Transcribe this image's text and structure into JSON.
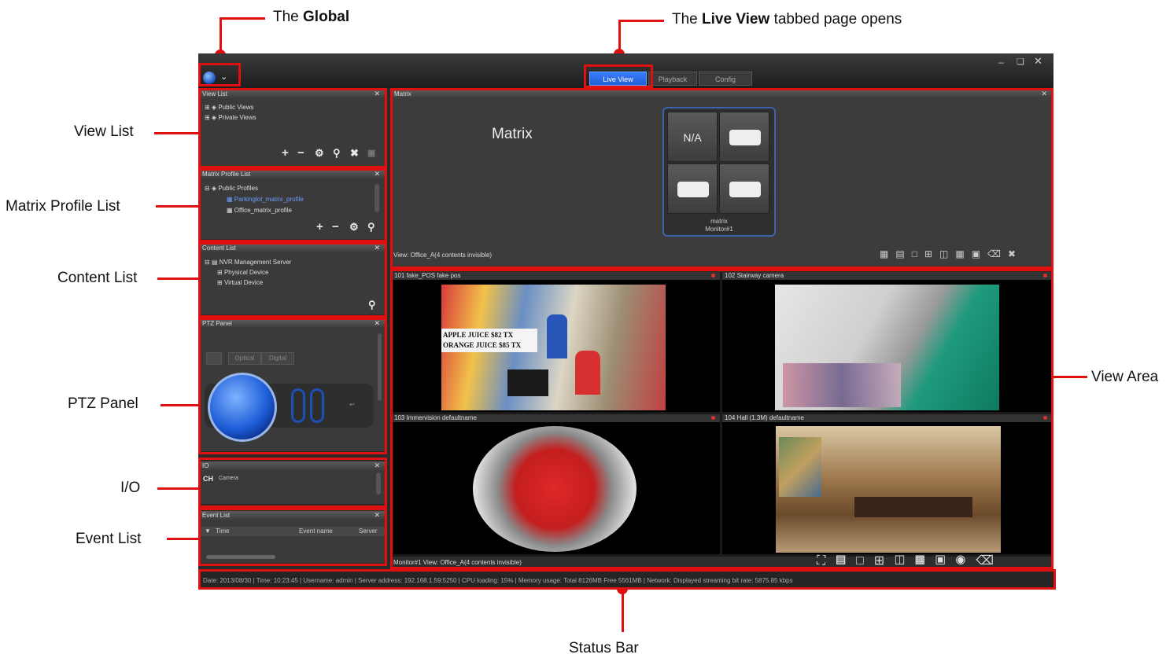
{
  "callouts": {
    "global_prefix": "The ",
    "global_bold": "Global",
    "liveview_prefix": "The ",
    "liveview_bold": "Live View",
    "liveview_suffix": " tabbed page opens",
    "view_list": "View List",
    "matrix_profile_list": "Matrix Profile List",
    "content_list": "Content List",
    "ptz_panel": "PTZ Panel",
    "io": "I/O",
    "event_list": "Event List",
    "view_area": "View Area",
    "status_bar": "Status Bar"
  },
  "tabs": [
    {
      "label": "Live View",
      "active": true
    },
    {
      "label": "Playback",
      "active": false
    },
    {
      "label": "Config",
      "active": false
    }
  ],
  "panels": {
    "view_list": {
      "title": "View List",
      "items": [
        "Public Views",
        "Private Views"
      ]
    },
    "matrix_profile": {
      "title": "Matrix Profile List",
      "items": [
        "Public Profiles",
        "Parkinglot_matrix_profile",
        "Office_matrix_profile"
      ]
    },
    "content_list": {
      "title": "Content List",
      "items": [
        "NVR Management Server",
        "Physical Device",
        "Virtual Device"
      ]
    },
    "ptz": {
      "title": "PTZ Panel",
      "tab_optical": "Optical",
      "tab_digital": "Digital"
    },
    "io": {
      "title": "IO",
      "ch_label": "CH",
      "camera_label": "Camera"
    },
    "event_list": {
      "title": "Event List",
      "col_time": "Time",
      "col_event": "Event name",
      "col_server": "Server"
    }
  },
  "matrix": {
    "header": "Matrix",
    "label": "Matrix",
    "cell_na": "N/A",
    "caption_line1": "matrix",
    "caption_line2": "Monitor#1",
    "view_label": "View: Office_A(4 contents invisible)"
  },
  "cameras": [
    {
      "title": "101  fake_POS  fake pos",
      "overlay1": "APPLE JUICE      $82 TX",
      "overlay2": "ORANGE JUICE    $85 TX"
    },
    {
      "title": "102  Stairway  camera"
    },
    {
      "title": "103  Immervision  defaultname"
    },
    {
      "title": "104  Hall (1.3M)  defaultname"
    }
  ],
  "viewarea_footer": "Monitor#1  View: Office_A(4 contents invisible)",
  "status_text": "Date: 2013/08/30  |  Time: 10:23:45  |  Username: admin  |  Server address: 192.168.1.59:5250  |  CPU loading: 15%  |  Memory usage: Total 8126MB Free 5561MB  |  Network: Displayed streaming bit rate: 5875.85 kbps",
  "colors": {
    "accent_red": "#e01010",
    "tab_active": "#1f5fd6",
    "window_bg": "#2a2a2a"
  },
  "icons": [
    "globe-icon",
    "chevron-down-icon",
    "minimize-icon",
    "restore-icon",
    "close-icon",
    "plus-icon",
    "minus-icon",
    "gear-icon",
    "search-icon",
    "tools-icon",
    "trash-icon",
    "camera-icon",
    "layout-grid-icon",
    "monitor-icon"
  ]
}
